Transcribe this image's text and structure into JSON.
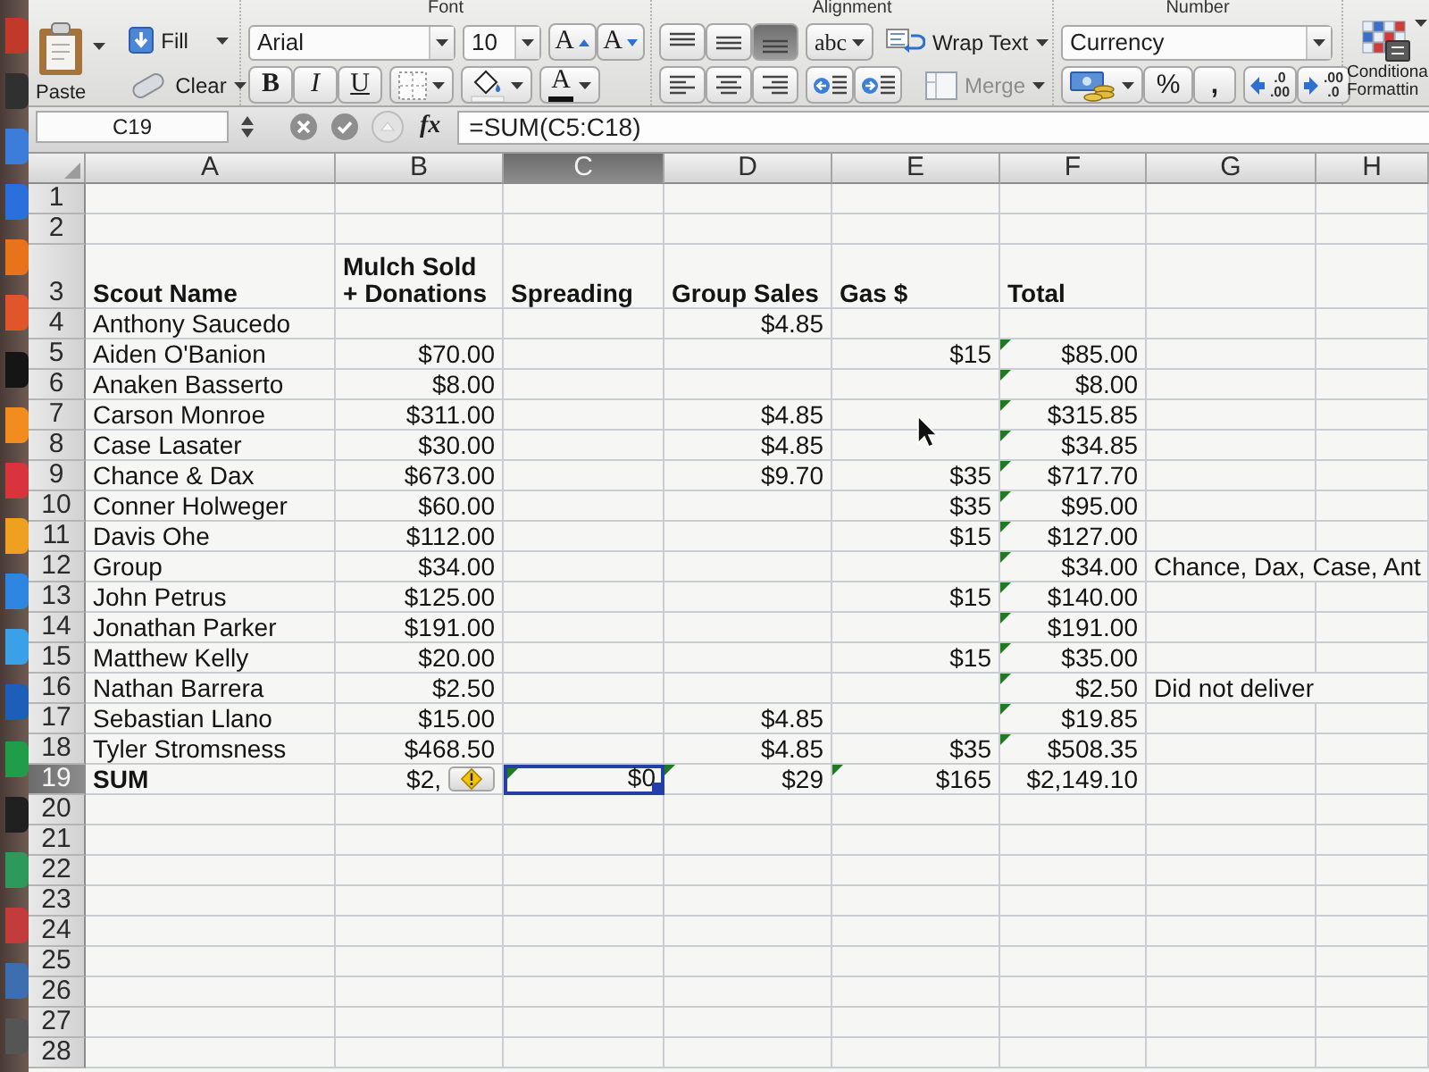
{
  "ribbon": {
    "group_labels": {
      "font": "Font",
      "alignment": "Alignment",
      "number": "Number"
    },
    "paste": {
      "label": "Paste"
    },
    "fill": {
      "label": "Fill"
    },
    "clear": {
      "label": "Clear"
    },
    "font_name": {
      "value": "Arial"
    },
    "font_size": {
      "value": "10"
    },
    "size_buttons": [
      {
        "kind": "grow",
        "label": "A"
      },
      {
        "kind": "shrink",
        "label": "A"
      }
    ],
    "style_buttons": [
      {
        "kind": "bold",
        "label": "B"
      },
      {
        "kind": "italic",
        "label": "I"
      },
      {
        "kind": "underline",
        "label": "U"
      }
    ],
    "font_color": {
      "label": "A"
    },
    "vertical_align": [
      {
        "kind": "top",
        "selected": false
      },
      {
        "kind": "middle",
        "selected": false
      },
      {
        "kind": "bottom",
        "selected": true
      }
    ],
    "orientation": {
      "label": "abc"
    },
    "wrap_text": {
      "label": "Wrap Text"
    },
    "horizontal_align": [
      {
        "kind": "left",
        "selected": false
      },
      {
        "kind": "center",
        "selected": false
      },
      {
        "kind": "right",
        "selected": false
      }
    ],
    "merge": {
      "label": "Merge",
      "disabled": true
    },
    "number_format": {
      "value": "Currency"
    },
    "number_buttons": [
      {
        "kind": "accounting"
      },
      {
        "kind": "percent",
        "label": "%"
      },
      {
        "kind": "comma",
        "label": ","
      }
    ],
    "decimal_buttons": [
      {
        "kind": "increase",
        "top": ".0",
        "bottom": ".00"
      },
      {
        "kind": "decrease",
        "top": ".00",
        "bottom": ".0"
      }
    ],
    "conditional_formatting": {
      "label": "Conditiona\nFormattin"
    }
  },
  "formula_bar": {
    "name_box": "C19",
    "function_label": "fx",
    "formula": "=SUM(C5:C18)"
  },
  "sheet": {
    "columns": [
      {
        "label": "A",
        "selected": false
      },
      {
        "label": "B",
        "selected": false
      },
      {
        "label": "C",
        "selected": true
      },
      {
        "label": "D",
        "selected": false
      },
      {
        "label": "E",
        "selected": false
      },
      {
        "label": "F",
        "selected": false
      },
      {
        "label": "G",
        "selected": false
      },
      {
        "label": "H",
        "selected": false
      }
    ],
    "rows": [
      {
        "number": "1",
        "kind": "blank",
        "selected": false
      },
      {
        "number": "2",
        "kind": "blank",
        "selected": false
      },
      {
        "number": "3",
        "kind": "header",
        "selected": false,
        "cells": {
          "scout_name": "Scout Name",
          "mulch_sold_donations": "Mulch Sold\n+ Donations",
          "spreading": "Spreading",
          "group_sales": "Group Sales",
          "gas": "Gas $",
          "total": "Total"
        }
      },
      {
        "number": "4",
        "kind": "data",
        "selected": false,
        "cells": {
          "scout_name": "Anthony Saucedo",
          "group_sales": "$4.85"
        }
      },
      {
        "number": "5",
        "kind": "data",
        "selected": false,
        "cells": {
          "scout_name": "Aiden O'Banion",
          "mulch_sold_donations": "$70.00",
          "gas": "$15",
          "total": "$85.00"
        },
        "error_flags": {
          "total": true
        }
      },
      {
        "number": "6",
        "kind": "data",
        "selected": false,
        "cells": {
          "scout_name": "Anaken Basserto",
          "mulch_sold_donations": "$8.00",
          "total": "$8.00"
        },
        "error_flags": {
          "total": true
        }
      },
      {
        "number": "7",
        "kind": "data",
        "selected": false,
        "cells": {
          "scout_name": "Carson Monroe",
          "mulch_sold_donations": "$311.00",
          "group_sales": "$4.85",
          "total": "$315.85"
        },
        "error_flags": {
          "total": true
        }
      },
      {
        "number": "8",
        "kind": "data",
        "selected": false,
        "cells": {
          "scout_name": "Case Lasater",
          "mulch_sold_donations": "$30.00",
          "group_sales": "$4.85",
          "total": "$34.85"
        },
        "error_flags": {
          "total": true
        }
      },
      {
        "number": "9",
        "kind": "data",
        "selected": false,
        "cells": {
          "scout_name": "Chance & Dax",
          "mulch_sold_donations": "$673.00",
          "group_sales": "$9.70",
          "gas": "$35",
          "total": "$717.70"
        },
        "error_flags": {
          "total": true
        }
      },
      {
        "number": "10",
        "kind": "data",
        "selected": false,
        "cells": {
          "scout_name": "Conner Holweger",
          "mulch_sold_donations": "$60.00",
          "gas": "$35",
          "total": "$95.00"
        },
        "error_flags": {
          "total": true
        }
      },
      {
        "number": "11",
        "kind": "data",
        "selected": false,
        "cells": {
          "scout_name": "Davis Ohe",
          "mulch_sold_donations": "$112.00",
          "gas": "$15",
          "total": "$127.00"
        },
        "error_flags": {
          "total": true
        }
      },
      {
        "number": "12",
        "kind": "data",
        "selected": false,
        "cells": {
          "scout_name": "Group",
          "mulch_sold_donations": "$34.00",
          "total": "$34.00",
          "column_7": "Chance, Dax, Case, Ant"
        },
        "error_flags": {
          "total": true
        }
      },
      {
        "number": "13",
        "kind": "data",
        "selected": false,
        "cells": {
          "scout_name": "John Petrus",
          "mulch_sold_donations": "$125.00",
          "gas": "$15",
          "total": "$140.00"
        },
        "error_flags": {
          "total": true
        }
      },
      {
        "number": "14",
        "kind": "data",
        "selected": false,
        "cells": {
          "scout_name": "Jonathan Parker",
          "mulch_sold_donations": "$191.00",
          "total": "$191.00"
        },
        "error_flags": {
          "total": true
        }
      },
      {
        "number": "15",
        "kind": "data",
        "selected": false,
        "cells": {
          "scout_name": "Matthew Kelly",
          "mulch_sold_donations": "$20.00",
          "gas": "$15",
          "total": "$35.00"
        },
        "error_flags": {
          "total": true
        }
      },
      {
        "number": "16",
        "kind": "data",
        "selected": false,
        "cells": {
          "scout_name": "Nathan Barrera",
          "mulch_sold_donations": "$2.50",
          "total": "$2.50",
          "column_7": "Did not deliver"
        },
        "error_flags": {
          "total": true
        }
      },
      {
        "number": "17",
        "kind": "data",
        "selected": false,
        "cells": {
          "scout_name": "Sebastian Llano",
          "mulch_sold_donations": "$15.00",
          "group_sales": "$4.85",
          "total": "$19.85"
        },
        "error_flags": {
          "total": true
        }
      },
      {
        "number": "18",
        "kind": "data",
        "selected": false,
        "cells": {
          "scout_name": "Tyler Stromsness",
          "mulch_sold_donations": "$468.50",
          "group_sales": "$4.85",
          "gas": "$35",
          "total": "$508.35"
        },
        "error_flags": {
          "total": true
        }
      },
      {
        "number": "19",
        "kind": "sum",
        "selected": true,
        "error_smart_tag": true,
        "cells": {
          "scout_name": "SUM",
          "mulch_sold_donations": "$2,",
          "spreading": "$0",
          "group_sales": "$29",
          "gas": "$165",
          "total": "$2,149.10"
        },
        "error_flags": {
          "spreading": true,
          "group_sales": true,
          "gas": true
        }
      },
      {
        "number": "20",
        "kind": "blank",
        "selected": false
      },
      {
        "number": "21",
        "kind": "blank",
        "selected": false
      },
      {
        "number": "22",
        "kind": "blank",
        "selected": false
      },
      {
        "number": "23",
        "kind": "blank",
        "selected": false
      },
      {
        "number": "24",
        "kind": "blank",
        "selected": false
      },
      {
        "number": "25",
        "kind": "blank",
        "selected": false
      },
      {
        "number": "26",
        "kind": "blank",
        "selected": false
      },
      {
        "number": "27",
        "kind": "blank",
        "selected": false
      },
      {
        "number": "28",
        "kind": "blank",
        "selected": false
      }
    ]
  }
}
